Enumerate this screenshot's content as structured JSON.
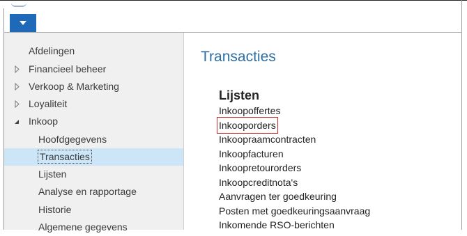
{
  "menu_button": {
    "icon": "chevron-down-icon"
  },
  "sidebar": {
    "items": [
      {
        "label": "Afdelingen",
        "level": 0,
        "arrow": "none"
      },
      {
        "label": "Financieel beheer",
        "level": 0,
        "arrow": "collapsed"
      },
      {
        "label": "Verkoop & Marketing",
        "level": 0,
        "arrow": "collapsed"
      },
      {
        "label": "Loyaliteit",
        "level": 0,
        "arrow": "collapsed"
      },
      {
        "label": "Inkoop",
        "level": 0,
        "arrow": "expanded"
      },
      {
        "label": "Hoofdgegevens",
        "level": 1,
        "arrow": "none"
      },
      {
        "label": "Transacties",
        "level": 1,
        "arrow": "none",
        "selected": true
      },
      {
        "label": "Lijsten",
        "level": 1,
        "arrow": "none"
      },
      {
        "label": "Analyse en rapportage",
        "level": 1,
        "arrow": "none"
      },
      {
        "label": "Historie",
        "level": 1,
        "arrow": "none"
      },
      {
        "label": "Algemene gegevens",
        "level": 1,
        "arrow": "none"
      }
    ]
  },
  "main": {
    "title": "Transacties",
    "section_heading": "Lijsten",
    "links": [
      {
        "label": "Inkoopoffertes"
      },
      {
        "label": "Inkooporders",
        "highlighted": true
      },
      {
        "label": "Inkoopraamcontracten"
      },
      {
        "label": "Inkoopfacturen"
      },
      {
        "label": "Inkoopretourorders"
      },
      {
        "label": "Inkoopcreditnota's"
      },
      {
        "label": "Aanvragen ter goedkeuring"
      },
      {
        "label": "Posten met goedkeuringsaanvraag"
      },
      {
        "label": "Inkomende RSO-berichten"
      }
    ]
  },
  "colors": {
    "accent_button": "#1e6ab8",
    "title_blue": "#2d6ea3",
    "selection_bg": "#cde6f7",
    "highlight_border": "#cc2b2b",
    "sidebar_bg": "#f0f0f0"
  }
}
